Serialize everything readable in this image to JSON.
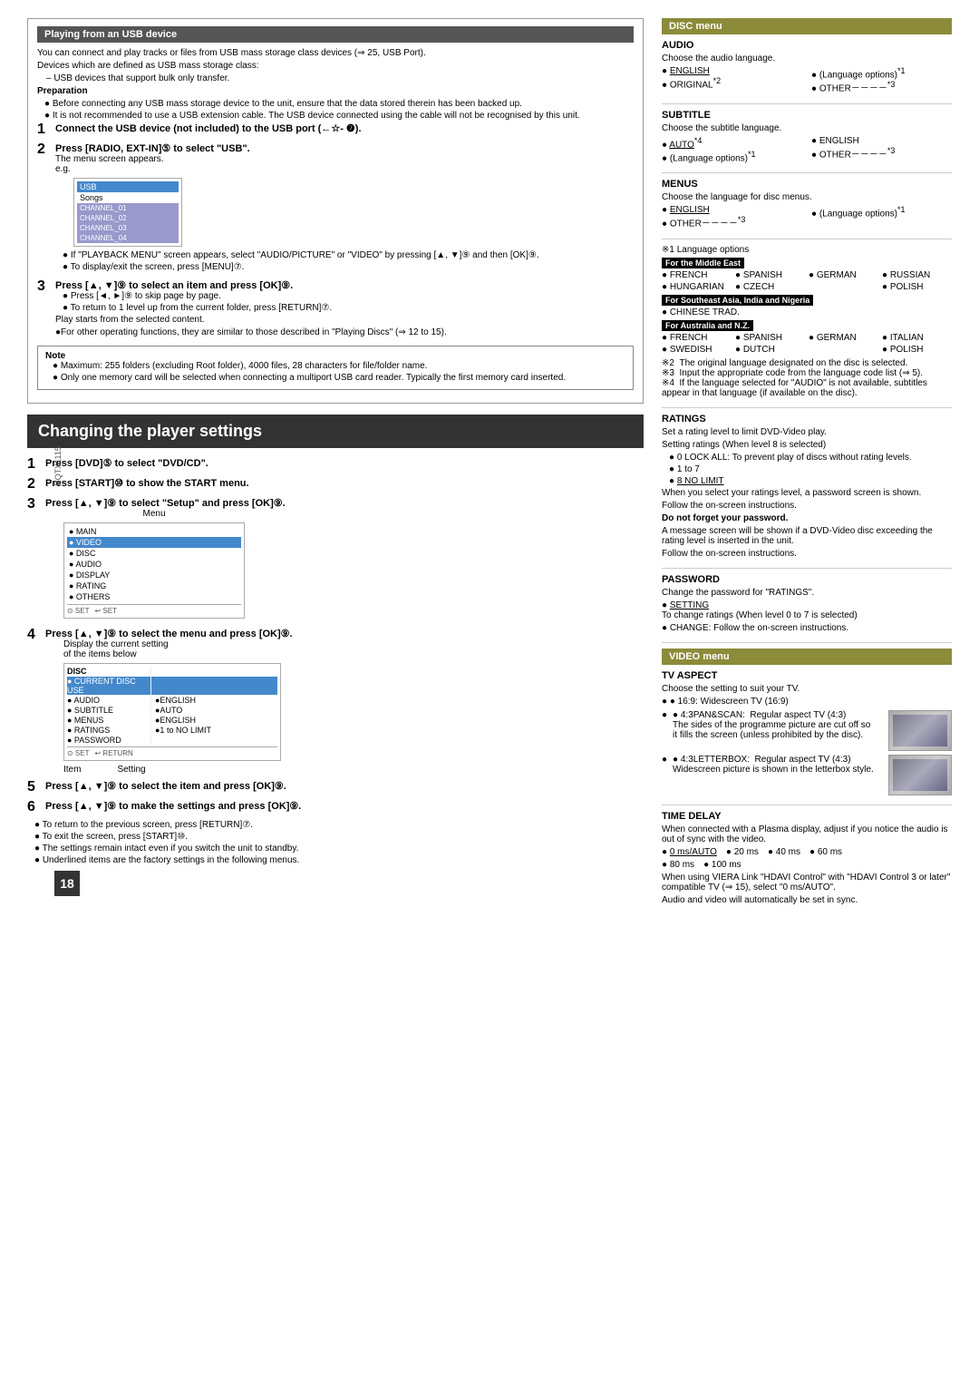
{
  "page": {
    "number": "18",
    "rqtx": "RQTX1115"
  },
  "usb_section": {
    "title": "Playing from an USB device",
    "intro": "You can connect and play tracks or files from USB mass storage class devices (⇒ 25, USB Port).",
    "devices_title": "Devices which are defined as USB mass storage class:",
    "devices_list": [
      "USB devices that support bulk only transfer."
    ],
    "prep_title": "Preparation",
    "prep_bullets": [
      "Before connecting any USB mass storage device to the unit, ensure that the data stored therein has been backed up.",
      "It is not recommended to use a USB extension cable. The USB device connected using the cable will not be recognised by this unit."
    ],
    "steps": [
      {
        "num": "1",
        "text": "Connect the USB device (not included) to the USB port (←☆- ⓿)."
      },
      {
        "num": "2",
        "text": "Press [RADIO, EXT-IN]⑤ to select \"USB\".",
        "note": "The menu screen appears.",
        "eg": "e.g."
      },
      {
        "num": "3",
        "text": "Press [▲, ▼]⑨ to select an item and press [OK]⑨.",
        "sub": [
          "Press [◄, ►]⑨ to skip page by page.",
          "To return to 1 level up from the current folder, press [RETURN]⑦."
        ],
        "play_note": "Play starts from the selected content.",
        "other_note": "●For other operating functions, they are similar to those described in \"Playing Discs\" (⇒ 12 to 15)."
      }
    ],
    "note_box": {
      "title": "Note",
      "items": [
        "Maximum: 255 folders (excluding Root folder), 4000 files, 28 characters for file/folder name.",
        "Only one memory card will be selected when connecting a multiport USB card reader. Typically the first memory card inserted."
      ]
    }
  },
  "changing_settings": {
    "title": "Changing the player settings",
    "steps": [
      {
        "num": "1",
        "text": "Press [DVD]⑤ to select \"DVD/CD\"."
      },
      {
        "num": "2",
        "text": "Press [START]⑩ to show the START menu."
      },
      {
        "num": "3",
        "text": "Press [▲, ▼]⑨ to select \"Setup\" and press [OK]⑨.",
        "label": "Menu",
        "menu_items": [
          "MAIN",
          "VIDEO",
          "DISC",
          "AUDIO",
          "DISPLAY",
          "RATING",
          "OTHERS"
        ]
      },
      {
        "num": "4",
        "text": "Press [▲, ▼]⑨ to select the menu and press [OK]⑨.",
        "label": "Display the current setting of the items below",
        "menu_items": [
          "DISC",
          "CURRENT DISC USE",
          "AUDIO",
          "SUBTITLE",
          "MENUS",
          "RATINGS",
          "PASSWORD"
        ],
        "settings_items": [
          "●ENGLISH",
          "●AUTO",
          "●ENGLISH",
          "●1 to NO LIMIT"
        ]
      },
      {
        "num": "5",
        "text": "Press [▲, ▼]⑨ to select the item and press [OK]⑨."
      },
      {
        "num": "6",
        "text": "Press [▲, ▼]⑨ to make the settings and press [OK]⑨."
      }
    ],
    "footer_bullets": [
      "To return to the previous screen, press [RETURN]⑦.",
      "To exit the screen, press [START]⑩.",
      "The settings remain intact even if you switch the unit to standby.",
      "Underlined items are the factory settings in the following menus."
    ],
    "item_label": "Item",
    "setting_label": "Setting"
  },
  "disc_menu": {
    "title": "DISC menu",
    "audio": {
      "title": "AUDIO",
      "desc": "Choose the audio language.",
      "items_left": [
        "● ENGLISH",
        "● ORIGINAL*2"
      ],
      "items_right": [
        "● (Language options)*1",
        "● OTHER－－－－*3"
      ]
    },
    "subtitle": {
      "title": "SUBTITLE",
      "desc": "Choose the subtitle language.",
      "items_col1": [
        "● AUTO*4",
        "● (Language options)*1"
      ],
      "items_col2": [
        "● ENGLISH",
        "● OTHER－－－－*3"
      ]
    },
    "menus": {
      "title": "MENUS",
      "desc": "Choose the language for disc menus.",
      "items_left": [
        "● ENGLISH",
        "● OTHER－－－－*3"
      ],
      "items_right": [
        "● (Language options)*1"
      ]
    },
    "footnote1": {
      "label": "※1 Language options",
      "middle_east": {
        "label": "For the Middle East",
        "row1": [
          "● FRENCH",
          "● SPANISH",
          "● GERMAN",
          "● RUSSIAN"
        ],
        "row2": [
          "● HUNGARIAN",
          "● CZECH",
          "",
          "● POLISH"
        ]
      },
      "southeast_asia": {
        "label": "For Southeast Asia, India and Nigeria",
        "row1": [
          "● CHINESE TRAD."
        ]
      },
      "australia": {
        "label": "For Australia and N.Z.",
        "row1": [
          "● FRENCH",
          "● SPANISH",
          "● GERMAN",
          "● ITALIAN"
        ],
        "row2": [
          "● SWEDISH",
          "● DUTCH",
          "",
          "● POLISH"
        ]
      }
    },
    "footnotes": [
      "※2  The original language designated on the disc is selected.",
      "※3  Input the appropriate code from the language code list (⇒ 5).",
      "※4  If the language selected for \"AUDIO\" is not available, subtitles appear in that language (if available on the disc)."
    ]
  },
  "ratings": {
    "title": "RATINGS",
    "desc": "Set a rating level to limit DVD-Video play.",
    "setting_note": "Setting ratings (When level 8 is selected)",
    "bullets": [
      "0 LOCK ALL: To prevent play of discs without rating levels.",
      "1 to 7",
      "8 NO LIMIT"
    ],
    "password_note": "When you select your ratings level, a password screen is shown.",
    "follow_note": "Follow the on-screen instructions.",
    "do_not_forget": {
      "title": "Do not forget your password.",
      "desc": "A message screen will be shown if a DVD-Video disc exceeding the rating level is inserted in the unit.",
      "follow": "Follow the on-screen instructions."
    }
  },
  "password": {
    "title": "PASSWORD",
    "desc": "Change the password for \"RATINGS\".",
    "bullets": [
      "● SETTING"
    ],
    "change_note": "To change ratings (When level 0 to 7 is selected)",
    "change_bullet": "● CHANGE: Follow the on-screen instructions."
  },
  "video_menu": {
    "title": "VIDEO menu",
    "tv_aspect": {
      "title": "TV ASPECT",
      "desc": "Choose the setting to suit your TV.",
      "bullets": [
        "16:9: Widescreen TV (16:9)",
        "4:3PAN&SCAN:  Regular aspect TV (4:3)\nThe sides of the programme picture are cut off so it fills the screen (unless prohibited by the disc).",
        "4:3LETTERBOX:  Regular aspect TV (4:3)\nWidescreen picture is shown in the letterbox style."
      ]
    },
    "time_delay": {
      "title": "TIME DELAY",
      "desc": "When connected with a Plasma display, adjust if you notice the audio is out of sync with the video.",
      "bullets": [
        "● 0 ms/AUTO",
        "● 20 ms",
        "● 40 ms",
        "● 60 ms"
      ],
      "bullets2": [
        "● 80 ms",
        "● 100 ms"
      ],
      "note1": "When using VIERA Link \"HDAVI Control\" with \"HDAVI Control 3 or later\" compatible TV (⇒ 15), select \"0 ms/AUTO\".",
      "note2": "Audio and video will automatically be set in sync."
    }
  }
}
